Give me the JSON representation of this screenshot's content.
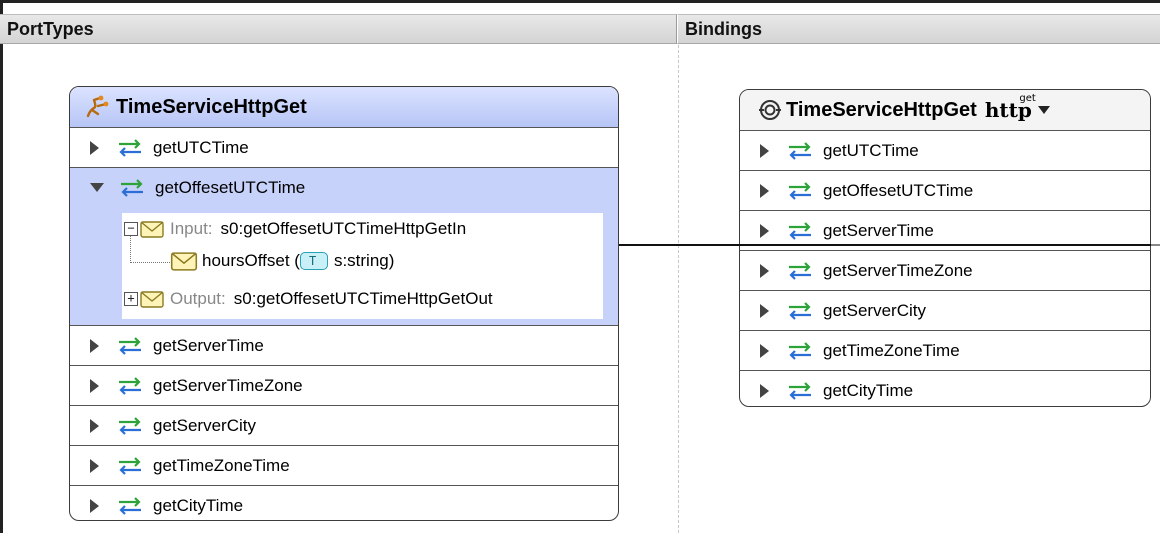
{
  "headers": {
    "porttypes": "PortTypes",
    "bindings": "Bindings"
  },
  "porttype": {
    "title": "TimeServiceHttpGet",
    "operations_before": [
      "getUTCTime"
    ],
    "expanded_operation": "getOffesetUTCTime",
    "input_label": "Input:",
    "input_message": "s0:getOffesetUTCTimeHttpGetIn",
    "part_name": "hoursOffset (",
    "part_type": "s:string)",
    "type_tag": "T",
    "output_label": "Output:",
    "output_message": "s0:getOffesetUTCTimeHttpGetOut",
    "operations_after": [
      "getServerTime",
      "getServerTimeZone",
      "getServerCity",
      "getTimeZoneTime",
      "getCityTime"
    ]
  },
  "binding": {
    "title": "TimeServiceHttpGet",
    "protocol": "http",
    "verb": "get",
    "operations": [
      "getUTCTime",
      "getOffesetUTCTime",
      "getServerTime",
      "getServerTimeZone",
      "getServerCity",
      "getTimeZoneTime",
      "getCityTime"
    ]
  },
  "colors": {
    "porttype_header": "#b7c5f6",
    "expanded_bg": "#c7d2fa",
    "swap_arrow": "#2ea33a",
    "swap_arrow_alt": "#2b6fd6"
  }
}
